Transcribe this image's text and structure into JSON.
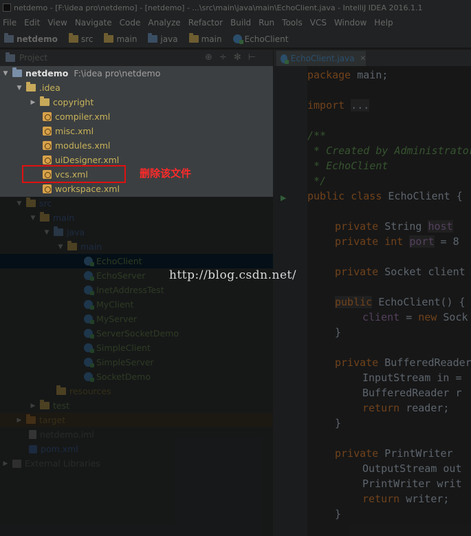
{
  "window": {
    "title": "netdemo - [F:\\idea pro\\netdemo] - [netdemo] - ...\\src\\main\\java\\main\\EchoClient.java - IntelliJ IDEA 2016.1.1"
  },
  "menu": [
    "File",
    "Edit",
    "View",
    "Navigate",
    "Code",
    "Analyze",
    "Refactor",
    "Build",
    "Run",
    "Tools",
    "VCS",
    "Window",
    "Help"
  ],
  "breadcrumbs": [
    "netdemo",
    "src",
    "main",
    "java",
    "main",
    "EchoClient"
  ],
  "project_panel": {
    "label": "Project",
    "tool_icons": [
      "⊕",
      "÷",
      "✻",
      "⊢"
    ]
  },
  "tree": {
    "root": {
      "name": "netdemo",
      "path": "F:\\idea pro\\netdemo"
    },
    "idea_folder": ".idea",
    "idea_children": [
      "copyright",
      "compiler.xml",
      "misc.xml",
      "modules.xml",
      "uiDesigner.xml",
      "vcs.xml",
      "workspace.xml"
    ],
    "src": "src",
    "main": "main",
    "java": "java",
    "pkg_main": "main",
    "classes": [
      "EchoClient",
      "EchoServer",
      "InetAddressTest",
      "MyClient",
      "MyServer",
      "ServerSocketDemo",
      "SimpleClient",
      "SimpleServer",
      "SocketDemo"
    ],
    "resources": "resources",
    "test": "test",
    "target": "target",
    "iml": "netdemo.iml",
    "pom": "pom.xml",
    "external": "External Libraries"
  },
  "annotation": {
    "text": "删除该文件",
    "color": "#ff2a2a"
  },
  "watermark": "http://blog.csdn.net/",
  "editor": {
    "tab": "EchoClient.java",
    "lines": {
      "l1": "main;",
      "l2": "...",
      "l3": "/**",
      "l4": " * Created by Administrator",
      "l5": " * EchoClient",
      "l6": " */",
      "l7": "EchoClient {",
      "l8a": "String ",
      "l8b": "host",
      "l9a": "int ",
      "l9b": "port",
      "l9c": " = 8",
      "l10": "Socket client",
      "l11": "EchoClient() {",
      "l12a": "client",
      "l12b": " = ",
      "l12c": "Sock",
      "l13": "}",
      "l14": "BufferedReader",
      "l15": "InputStream in = ",
      "l16": "BufferedReader r",
      "l17": "reader;",
      "l18": "}",
      "l19": "PrintWriter",
      "l20": "OutputStream out",
      "l21": "PrintWriter writ",
      "l22": "writer;",
      "l23": "}"
    },
    "kw": {
      "package": "package",
      "import": "import",
      "public": "public",
      "class": "class",
      "private": "private",
      "new": "new",
      "return": "return"
    }
  }
}
